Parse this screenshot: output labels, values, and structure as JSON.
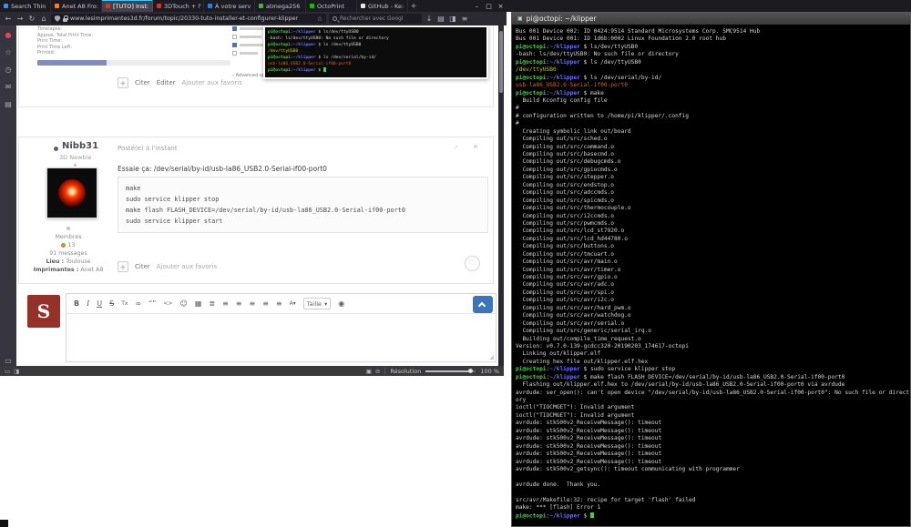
{
  "browser": {
    "tabs": [
      {
        "label": "Search Thin",
        "color": "#4a90d9",
        "active": false
      },
      {
        "label": "Anet A8 Fro:",
        "color": "#e08a2e",
        "active": false
      },
      {
        "label": "[TUTO] Inst:",
        "color": "#c63d2f",
        "active": true
      },
      {
        "label": "3DTouch + l'",
        "color": "#c63d2f",
        "active": false
      },
      {
        "label": "À votre serv",
        "color": "#2f7fd0",
        "active": false
      },
      {
        "label": "atmega256",
        "color": "#58a55c",
        "active": false
      },
      {
        "label": "OctoPrint",
        "color": "#13c100",
        "active": false
      },
      {
        "label": "GitHub - Ke:",
        "color": "#e8e8e8",
        "active": false
      }
    ],
    "new_tab_label": "+",
    "window_controls": [
      {
        "name": "minimize-button",
        "glyph": "–"
      },
      {
        "name": "maximize-button",
        "glyph": "□"
      },
      {
        "name": "close-button",
        "glyph": "×"
      }
    ],
    "nav": {
      "url": "www.lesimprimantes3d.fr/forum/topic/20330-tuto-installer-et-configurer-klipper",
      "search_placeholder": "Rechercher avec Googl"
    },
    "nav_left_icons": [
      {
        "name": "back-icon",
        "glyph": "←"
      },
      {
        "name": "forward-icon",
        "glyph": "→"
      },
      {
        "name": "refresh-icon",
        "glyph": "↻"
      },
      {
        "name": "home-icon",
        "glyph": "⌂"
      }
    ],
    "nav_right_icons": [
      {
        "name": "downloads-icon",
        "glyph": "↓"
      },
      {
        "name": "library-icon",
        "glyph": "▤"
      },
      {
        "name": "sidebar-toggle-icon",
        "glyph": "◨"
      },
      {
        "name": "menu-icon",
        "glyph": "≡"
      }
    ],
    "sidebar_icons": [
      {
        "name": "pocket-icon",
        "glyph": "●",
        "color": "#ef4056"
      },
      {
        "name": "bookmark-star-icon",
        "glyph": "☆",
        "color": "#a9a9b5"
      },
      {
        "name": "history-clock-icon",
        "glyph": "◷",
        "color": "#a9a9b5"
      },
      {
        "name": "mail-icon",
        "glyph": "✉",
        "color": "#a9a9b5"
      },
      {
        "name": "pages-icon",
        "glyph": "▤",
        "color": "#a9a9b5"
      }
    ],
    "sidebar_bottom_icons": [
      {
        "name": "display-icon",
        "glyph": "▭",
        "color": "#a9a9b5"
      }
    ],
    "statusbar": {
      "left_icons": [
        {
          "name": "display-icon",
          "glyph": "▭"
        },
        {
          "name": "windows-icon",
          "glyph": "◨"
        }
      ],
      "right_icons": [
        {
          "name": "camera-icon",
          "glyph": "▣"
        },
        {
          "name": "zoom-out-icon",
          "glyph": "⊖"
        }
      ],
      "resolution_label": "Résolution",
      "zoom_level": "100 %"
    }
  },
  "page": {
    "post_top": {
      "stats_labels": [
        "Timelapse:",
        "Approx. Total Print Time:",
        "Print Time:",
        "Print Time Left:",
        "Printed:"
      ],
      "progress_percent": 36,
      "advanced_label": "› Advanced options",
      "actions": [
        "Citer",
        "Éditer",
        "Ajouter aux favoris"
      ],
      "plus_label": "+"
    },
    "post": {
      "author": "Nibb31",
      "author_title": "3D Newbie",
      "posted": "Posté(e) à l'instant",
      "body": "Essaie ça: /dev/serial/by-id/usb-la86_USB2.0-Serial-if00-port0",
      "code_lines": [
        "make",
        "sudo service klipper stop",
        "make flash FLASH_DEVICE=/dev/serial/by-id/usb-la86_USB2.0-Serial-if00-port0",
        "sudo service klipper start"
      ],
      "group": "Membres",
      "reputation": "13",
      "messages": "91 messages",
      "location_label": "Lieu :",
      "location_value": "Toulouse",
      "printers_label": "Imprimantes :",
      "printers_value": "Anet A8",
      "actions": [
        "Citer",
        "Ajouter aux favoris"
      ],
      "plus_label": "+",
      "heart_glyph": "♡",
      "share_glyph": "↗",
      "flag_glyph": "⚑"
    },
    "editor": {
      "avatar_letter": "S",
      "size_label": "Taille",
      "chevron": "▾",
      "toolbar_icons": [
        {
          "name": "bold-icon",
          "glyph": "B",
          "s": "b"
        },
        {
          "name": "italic-icon",
          "glyph": "I",
          "s": "i"
        },
        {
          "name": "underline-icon",
          "glyph": "U",
          "s": "u"
        },
        {
          "name": "strikethrough-icon",
          "glyph": "S",
          "s": "st"
        },
        {
          "name": "remove-format-icon",
          "glyph": "Tx",
          "s": "sm"
        },
        {
          "name": "link-icon",
          "glyph": "∞",
          "s": ""
        },
        {
          "name": "quote-icon",
          "glyph": "“”",
          "s": ""
        },
        {
          "name": "code-icon",
          "glyph": "<>",
          "s": "sm"
        },
        {
          "name": "emoji-icon",
          "glyph": "☺",
          "s": ""
        },
        {
          "name": "table-icon",
          "glyph": "▦",
          "s": ""
        },
        {
          "name": "list-ol-icon",
          "glyph": "≣",
          "s": ""
        },
        {
          "name": "list-ul-icon",
          "glyph": "≡",
          "s": ""
        },
        {
          "name": "align-left-icon",
          "glyph": "≡",
          "s": ""
        },
        {
          "name": "align-center-icon",
          "glyph": "≡",
          "s": ""
        },
        {
          "name": "align-right-icon",
          "glyph": "≡",
          "s": ""
        },
        {
          "name": "justify-icon",
          "glyph": "≡",
          "s": ""
        },
        {
          "name": "text-color-icon",
          "glyph": "A▾",
          "s": "sm"
        }
      ],
      "preview_icon_glyph": "◉"
    }
  },
  "terminal": {
    "title": "pi@octopi: ~/klipper",
    "title_icon_glyph": "▣",
    "prompt_user": "pi@octopi",
    "prompt_path": "~/klipper",
    "mini_lines": [
      [
        [
          "P",
          ""
        ],
        [
          "w",
          " $ ls/dev/ttyUSB0"
        ]
      ],
      [
        [
          "w",
          "-bash: ls/dev/ttyUSB0: No such file or directory"
        ]
      ],
      [
        [
          "P",
          ""
        ],
        [
          "w",
          " $ ls /dev/ttyUSB0"
        ]
      ],
      [
        [
          "y",
          "/dev/ttyUSB0"
        ]
      ],
      [
        [
          "P",
          ""
        ],
        [
          "w",
          " $ ls /dev/serial/by-id/"
        ]
      ],
      [
        [
          "o",
          "usb-la86_USB2.0-Serial-if00-port0"
        ]
      ],
      [
        [
          "P",
          ""
        ],
        [
          "w",
          " $ "
        ],
        [
          "k",
          ""
        ]
      ]
    ],
    "lines": [
      [
        [
          "w",
          "Bus 001 Device 002: ID 0424:9514 Standard Microsystems Corp. SMC9514 Hub"
        ]
      ],
      [
        [
          "w",
          "Bus 001 Device 001: ID 1d6b:0002 Linux Foundation 2.0 root hub"
        ]
      ],
      [
        [
          "P",
          ""
        ],
        [
          "w",
          " $ ls/dev/ttyUSB0"
        ]
      ],
      [
        [
          "w",
          "-bash: ls/dev/ttyUSB0: No such file or directory"
        ]
      ],
      [
        [
          "P",
          ""
        ],
        [
          "w",
          " $ ls /dev/ttyUSB0"
        ]
      ],
      [
        [
          "y",
          "/dev/ttyUSB0"
        ]
      ],
      [
        [
          "P",
          ""
        ],
        [
          "w",
          " $ ls /dev/serial/by-id/"
        ]
      ],
      [
        [
          "o",
          "usb-la86_USB2.0-Serial-if00-port0"
        ]
      ],
      [
        [
          "P",
          ""
        ],
        [
          "w",
          " $ make"
        ]
      ],
      [
        [
          "w",
          "  Build Kconfig config file"
        ]
      ],
      [
        [
          "w",
          "#"
        ]
      ],
      [
        [
          "w",
          "# configuration written to /home/pi/klipper/.config"
        ]
      ],
      [
        [
          "w",
          "#"
        ]
      ],
      [
        [
          "w",
          "  Creating symbolic link out/board"
        ]
      ],
      [
        [
          "w",
          "  Compiling out/src/sched.o"
        ]
      ],
      [
        [
          "w",
          "  Compiling out/src/command.o"
        ]
      ],
      [
        [
          "w",
          "  Compiling out/src/basecmd.o"
        ]
      ],
      [
        [
          "w",
          "  Compiling out/src/debugcmds.o"
        ]
      ],
      [
        [
          "w",
          "  Compiling out/src/gpiocmds.o"
        ]
      ],
      [
        [
          "w",
          "  Compiling out/src/stepper.o"
        ]
      ],
      [
        [
          "w",
          "  Compiling out/src/endstop.o"
        ]
      ],
      [
        [
          "w",
          "  Compiling out/src/adccmds.o"
        ]
      ],
      [
        [
          "w",
          "  Compiling out/src/spicmds.o"
        ]
      ],
      [
        [
          "w",
          "  Compiling out/src/thermocouple.o"
        ]
      ],
      [
        [
          "w",
          "  Compiling out/src/i2ccmds.o"
        ]
      ],
      [
        [
          "w",
          "  Compiling out/src/pwmcmds.o"
        ]
      ],
      [
        [
          "w",
          "  Compiling out/src/lcd_st7920.o"
        ]
      ],
      [
        [
          "w",
          "  Compiling out/src/lcd_hd44780.o"
        ]
      ],
      [
        [
          "w",
          "  Compiling out/src/buttons.o"
        ]
      ],
      [
        [
          "w",
          "  Compiling out/src/tmcuart.o"
        ]
      ],
      [
        [
          "w",
          "  Compiling out/src/avr/main.o"
        ]
      ],
      [
        [
          "w",
          "  Compiling out/src/avr/timer.o"
        ]
      ],
      [
        [
          "w",
          "  Compiling out/src/avr/gpio.o"
        ]
      ],
      [
        [
          "w",
          "  Compiling out/src/avr/adc.o"
        ]
      ],
      [
        [
          "w",
          "  Compiling out/src/avr/spi.o"
        ]
      ],
      [
        [
          "w",
          "  Compiling out/src/avr/i2c.o"
        ]
      ],
      [
        [
          "w",
          "  Compiling out/src/avr/hard_pwm.o"
        ]
      ],
      [
        [
          "w",
          "  Compiling out/src/avr/watchdog.o"
        ]
      ],
      [
        [
          "w",
          "  Compiling out/src/avr/serial.o"
        ]
      ],
      [
        [
          "w",
          "  Compiling out/src/generic/serial_irq.o"
        ]
      ],
      [
        [
          "w",
          "  Building out/compile_time_request.o"
        ]
      ],
      [
        [
          "w",
          "Version: v0.7.0-139-gcdcc320-20190203_174617-octopi"
        ]
      ],
      [
        [
          "w",
          "  Linking out/klipper.elf"
        ]
      ],
      [
        [
          "w",
          "  Creating hex file out/klipper.elf.hex"
        ]
      ],
      [
        [
          "P",
          ""
        ],
        [
          "w",
          " $ sudo service klipper stop"
        ]
      ],
      [
        [
          "P",
          ""
        ],
        [
          "w",
          " $ make flash FLASH_DEVICE=/dev/serial/by-id/usb-la86_USB2.0-Serial-if00-port0"
        ]
      ],
      [
        [
          "w",
          "  Flashing out/klipper.elf.hex to /dev/serial/by-id/usb-la86_USB2.0-Serial-if00-port0 via avrdude"
        ]
      ],
      [
        [
          "w",
          "avrdude: ser_open(): can't open device \"/dev/serial/by-id/usb-la86_USB2.0-Serial-if00-port0\": No such file or direct"
        ]
      ],
      [
        [
          "w",
          "ory"
        ]
      ],
      [
        [
          "w",
          "ioctl(\"TIOCMGET\"): Invalid argument"
        ]
      ],
      [
        [
          "w",
          "ioctl(\"TIOCMGET\"): Invalid argument"
        ]
      ],
      [
        [
          "w",
          "avrdude: stk500v2_ReceiveMessage(): timeout"
        ]
      ],
      [
        [
          "w",
          "avrdude: stk500v2_ReceiveMessage(): timeout"
        ]
      ],
      [
        [
          "w",
          "avrdude: stk500v2_ReceiveMessage(): timeout"
        ]
      ],
      [
        [
          "w",
          "avrdude: stk500v2_ReceiveMessage(): timeout"
        ]
      ],
      [
        [
          "w",
          "avrdude: stk500v2_ReceiveMessage(): timeout"
        ]
      ],
      [
        [
          "w",
          "avrdude: stk500v2_ReceiveMessage(): timeout"
        ]
      ],
      [
        [
          "w",
          "avrdude: stk500v2_getsync(): timeout communicating with programmer"
        ]
      ],
      [],
      [
        [
          "w",
          "avrdude done.  Thank you."
        ]
      ],
      [],
      [
        [
          "w",
          "src/avr/Makefile:32: recipe for target 'flash' failed"
        ]
      ],
      [
        [
          "w",
          "make: *** [flash] Error 1"
        ]
      ],
      [
        [
          "P",
          ""
        ],
        [
          "w",
          " $ "
        ],
        [
          "k",
          ""
        ]
      ]
    ]
  }
}
